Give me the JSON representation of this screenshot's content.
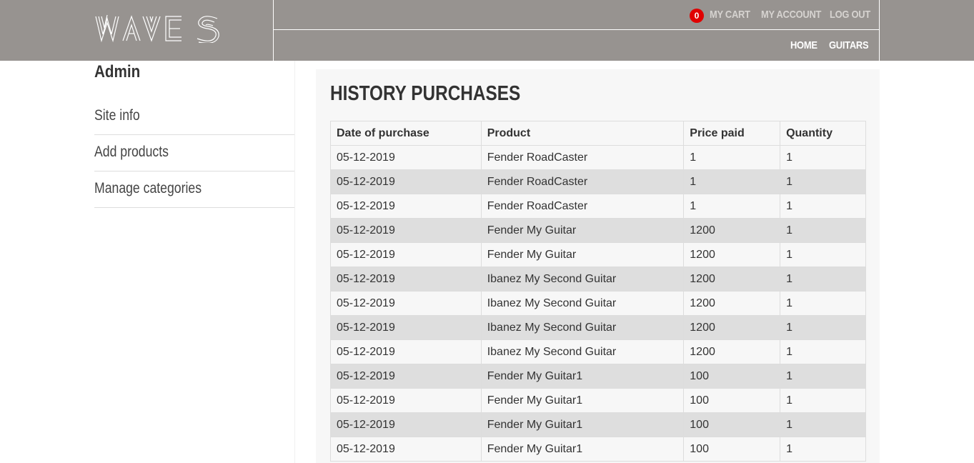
{
  "brand": {
    "logo_text": "WAVES"
  },
  "header": {
    "cart_count": "0",
    "my_cart": "MY CART",
    "my_account": "MY ACCOUNT",
    "log_out": "LOG OUT",
    "home": "HOME",
    "guitars": "GUITARS"
  },
  "sidebar": {
    "title": "Admin",
    "items": [
      {
        "label": "Site info"
      },
      {
        "label": "Add products"
      },
      {
        "label": "Manage categories"
      }
    ]
  },
  "main": {
    "title": "HISTORY PURCHASES",
    "columns": [
      "Date of purchase",
      "Product",
      "Price paid",
      "Quantity"
    ],
    "rows": [
      [
        "05-12-2019",
        "Fender RoadCaster",
        "1",
        "1"
      ],
      [
        "05-12-2019",
        "Fender RoadCaster",
        "1",
        "1"
      ],
      [
        "05-12-2019",
        "Fender RoadCaster",
        "1",
        "1"
      ],
      [
        "05-12-2019",
        "Fender My Guitar",
        "1200",
        "1"
      ],
      [
        "05-12-2019",
        "Fender My Guitar",
        "1200",
        "1"
      ],
      [
        "05-12-2019",
        "Ibanez My Second Guitar",
        "1200",
        "1"
      ],
      [
        "05-12-2019",
        "Ibanez My Second Guitar",
        "1200",
        "1"
      ],
      [
        "05-12-2019",
        "Ibanez My Second Guitar",
        "1200",
        "1"
      ],
      [
        "05-12-2019",
        "Ibanez My Second Guitar",
        "1200",
        "1"
      ],
      [
        "05-12-2019",
        "Fender My Guitar1",
        "100",
        "1"
      ],
      [
        "05-12-2019",
        "Fender My Guitar1",
        "100",
        "1"
      ],
      [
        "05-12-2019",
        "Fender My Guitar1",
        "100",
        "1"
      ],
      [
        "05-12-2019",
        "Fender My Guitar1",
        "100",
        "1"
      ]
    ]
  },
  "colors": {
    "header_bg": "#979390",
    "badge_red": "#e00000",
    "row_alt": "#dedede",
    "panel_bg": "#f7f7f7"
  }
}
